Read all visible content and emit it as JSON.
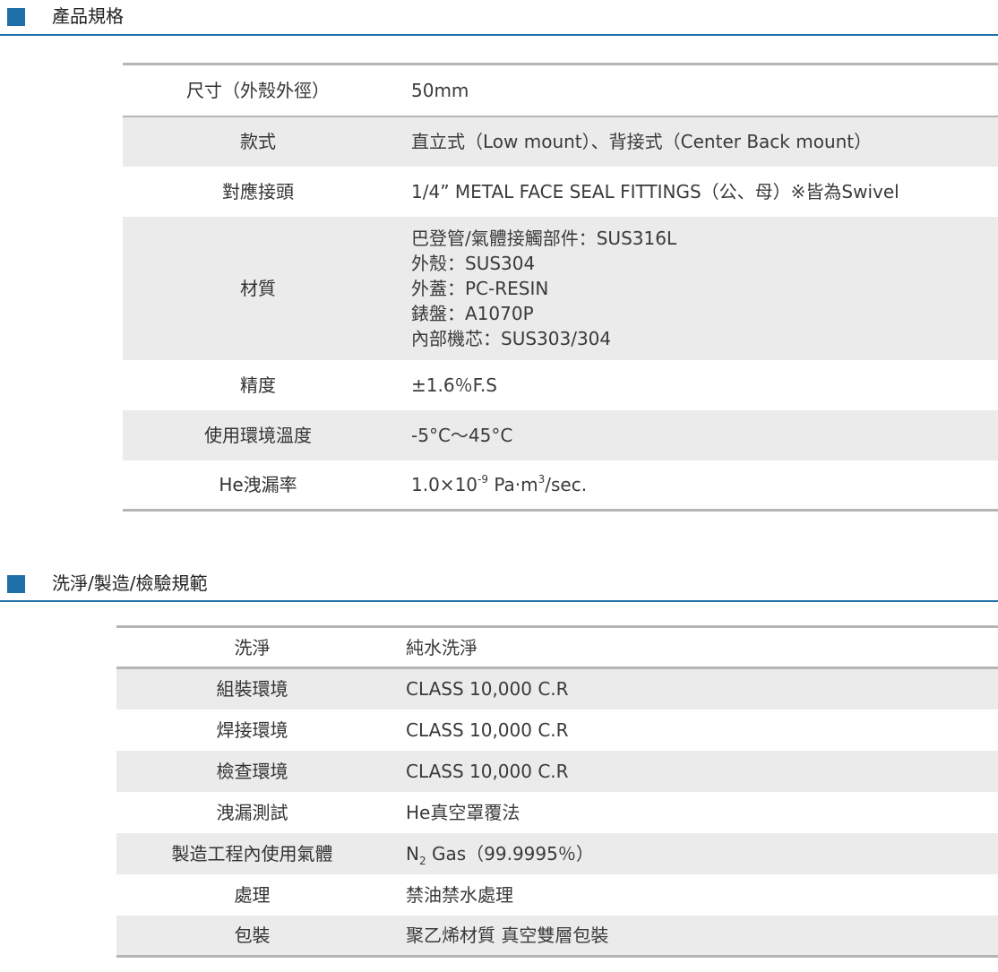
{
  "theme": {
    "accent": "#1f6fa9",
    "row_shade": "#ebebeb",
    "table_rule": "#b5b5b5"
  },
  "section1": {
    "title": "產品規格",
    "rows": [
      {
        "label": "尺寸（外殼外徑）",
        "value": "50mm"
      },
      {
        "label": "款式",
        "value": "直立式（Low mount）、背接式（Center Back mount）"
      },
      {
        "label": "對應接頭",
        "value": "1/4”  METAL FACE SEAL FITTINGS（公、母）※皆為Swivel"
      },
      {
        "label": "材質",
        "lines": [
          "巴登管/氣體接觸部件：SUS316L",
          "外殼：SUS304",
          "外蓋：PC-RESIN",
          "錶盤：A1070P",
          "內部機芯：SUS303/304"
        ]
      },
      {
        "label": "精度",
        "value": "±1.6％F.S"
      },
      {
        "label": "使用環境溫度",
        "value": "-5°C～45°C"
      },
      {
        "label": "He洩漏率",
        "value_pre": "1.0×10",
        "value_sup": "-9",
        "value_mid": " Pa·m",
        "value_sup2": "3",
        "value_post": "/sec."
      }
    ]
  },
  "section2": {
    "title": "洗淨/製造/檢驗規範",
    "rows": [
      {
        "label": "洗淨",
        "value": "純水洗淨"
      },
      {
        "label": "組裝環境",
        "value": "CLASS 10,000 C.R"
      },
      {
        "label": "焊接環境",
        "value": "CLASS 10,000 C.R"
      },
      {
        "label": "檢查環境",
        "value": "CLASS 10,000 C.R"
      },
      {
        "label": "洩漏測試",
        "value": "He真空罩覆法"
      },
      {
        "label": "製造工程內使用氣體",
        "value_pre": "N",
        "value_sub": "2",
        "value_post": " Gas（99.9995％）"
      },
      {
        "label": "處理",
        "value": "禁油禁水處理"
      },
      {
        "label": "包裝",
        "value": "聚乙烯材質 真空雙層包裝"
      }
    ]
  }
}
